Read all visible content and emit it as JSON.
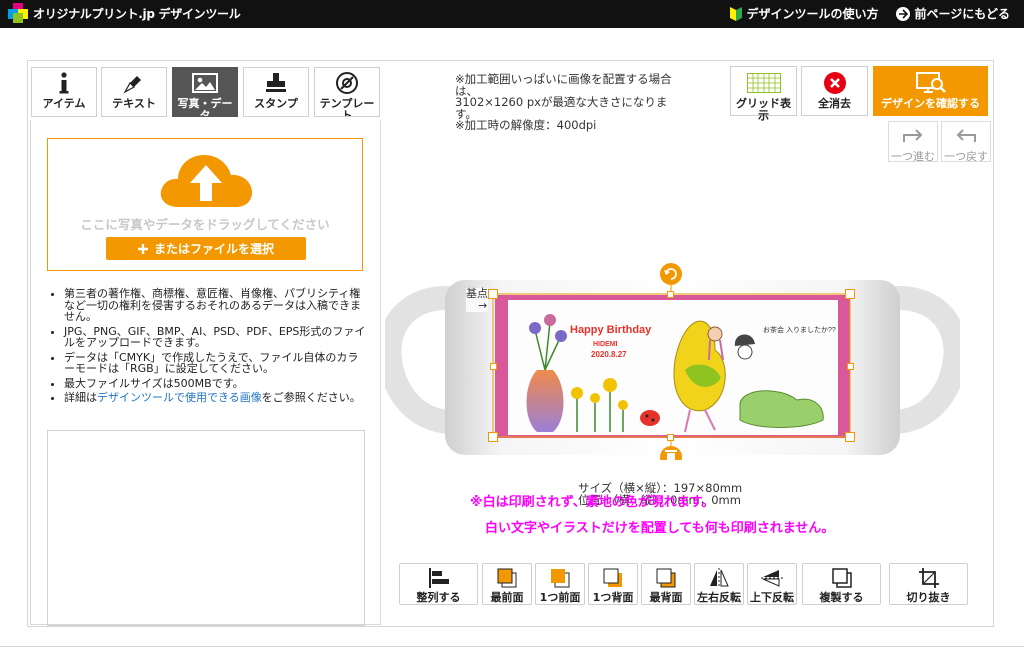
{
  "header": {
    "logo_text": "オリジナルプリント.jp デザインツール",
    "how_to": "デザインツールの使い方",
    "back": "前ページにもどる"
  },
  "tabs": [
    {
      "label": "アイテム",
      "icon": "info-icon"
    },
    {
      "label": "テキスト",
      "icon": "pen-icon"
    },
    {
      "label": "写真・データ",
      "icon": "image-icon",
      "active": true
    },
    {
      "label": "スタンプ",
      "icon": "stamp-icon"
    },
    {
      "label": "テンプレート",
      "icon": "template-icon"
    }
  ],
  "upload": {
    "drop_text": "ここに写真やデータをドラッグしてください",
    "file_button": "またはファイルを選択"
  },
  "notes": [
    "第三者の著作権、商標権、意匠権、肖像権、パブリシティ権など一切の権利を侵害するおそれのあるデータは入稿できません。",
    "JPG、PNG、GIF、BMP、AI、PSD、PDF、EPS形式のファイルをアップロードできます。",
    "データは「CMYK」で作成したうえで、ファイル自体のカラーモードは「RGB」に設定してください。",
    "最大ファイルサイズは500MBです。"
  ],
  "note_link": {
    "prefix": "詳細は",
    "link": "デザインツールで使用できる画像",
    "suffix": "をご参照ください。"
  },
  "info": {
    "line1": "※加工範囲いっぱいに画像を配置する場合は、",
    "line2": "3102×1260 pxが最適な大きさになります。",
    "line3": "※加工時の解像度：400dpi"
  },
  "toolbar": {
    "grid": "グリッド表示",
    "clear": "全消去",
    "confirm": "デザインを確認する",
    "redo": "一つ進む",
    "undo": "一つ戻す"
  },
  "canvas": {
    "origin_label": "基点",
    "origin_arrow": "→",
    "size_line1": "サイズ（横×縦）：197×80mm",
    "size_line2": "位置　（横，縦）：0mm，0mm",
    "artwork": {
      "title": "Happy Birthday",
      "name": "HIDEMI",
      "date": "2020.8.27",
      "speech": "お茶会 入りましたか??"
    }
  },
  "warnings": {
    "line1": "※白は印刷されず、素地の色が現れます。",
    "line2": "白い文字やイラストだけを配置しても何も印刷されません。"
  },
  "bottom_toolbar": [
    {
      "label": "整列する",
      "icon": "align-icon"
    },
    {
      "label": "最前面",
      "icon": "bring-front-icon"
    },
    {
      "label": "1つ前面",
      "icon": "bring-forward-icon"
    },
    {
      "label": "1つ背面",
      "icon": "send-backward-icon"
    },
    {
      "label": "最背面",
      "icon": "send-back-icon"
    },
    {
      "label": "左右反転",
      "icon": "flip-horizontal-icon"
    },
    {
      "label": "上下反転",
      "icon": "flip-vertical-icon"
    },
    {
      "label": "複製する",
      "icon": "duplicate-icon"
    },
    {
      "label": "切り抜き",
      "icon": "crop-icon"
    }
  ],
  "colors": {
    "accent": "#f39800",
    "header_bg": "#111111",
    "warning": "#ff00ff",
    "link": "#1e74c8",
    "active_tab": "#555555"
  }
}
